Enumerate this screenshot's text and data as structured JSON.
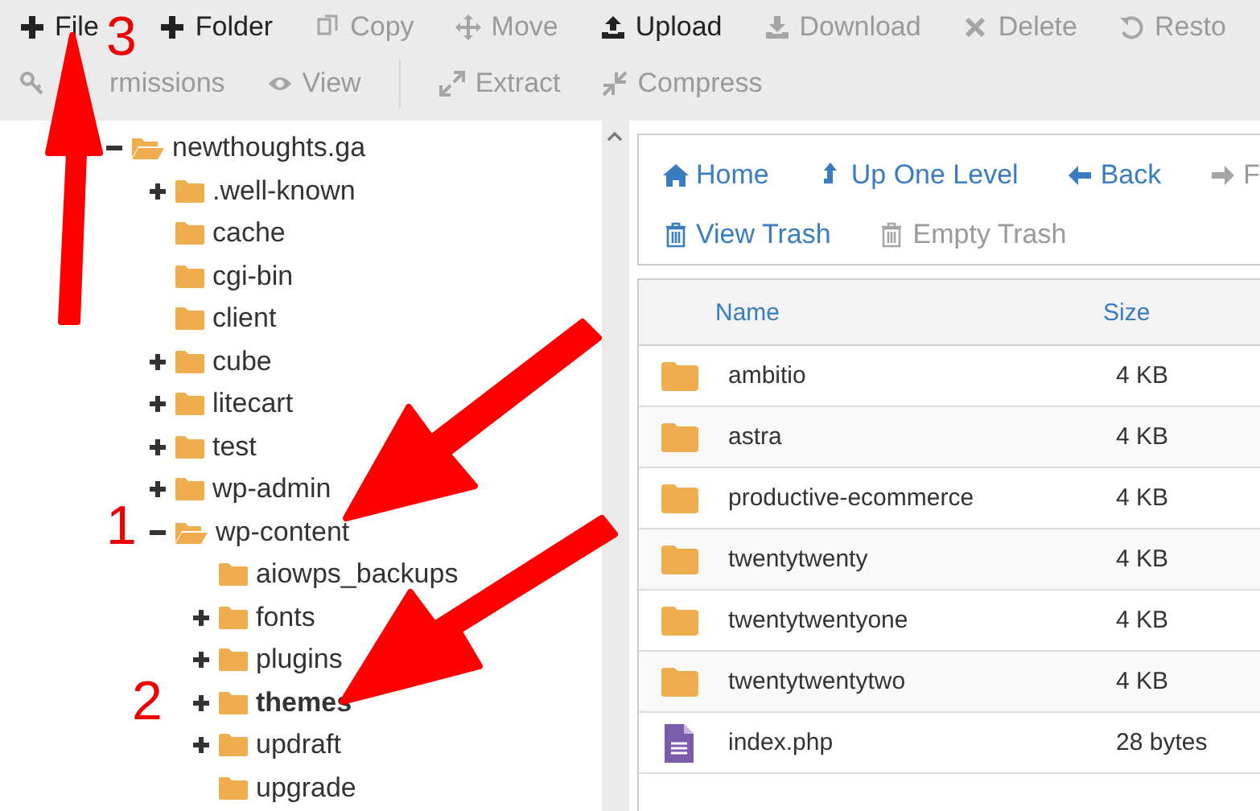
{
  "toolbar": {
    "actions": [
      {
        "kind": "plus",
        "label": "File",
        "disabled": false
      },
      {
        "kind": "plus",
        "label": "Folder",
        "disabled": false
      },
      {
        "kind": "copy",
        "label": "Copy",
        "disabled": true
      },
      {
        "kind": "move",
        "label": "Move",
        "disabled": true
      },
      {
        "kind": "upload",
        "label": "Upload",
        "disabled": false
      },
      {
        "kind": "download",
        "label": "Download",
        "disabled": true
      },
      {
        "kind": "delete",
        "label": "Delete",
        "disabled": true
      },
      {
        "kind": "restore",
        "label": "Resto",
        "disabled": true
      }
    ],
    "tools": [
      {
        "kind": "key",
        "label": "rmissions",
        "disabled": true
      },
      {
        "kind": "eye",
        "label": "View",
        "disabled": true
      },
      {
        "kind": "extract",
        "label": "Extract",
        "disabled": true
      },
      {
        "kind": "compress",
        "label": "Compress",
        "disabled": true
      }
    ]
  },
  "tree": [
    {
      "name": "newthoughts.ga",
      "has_children": true,
      "expanded": true,
      "selected": false,
      "children": [
        {
          "name": ".well-known",
          "has_children": true,
          "expanded": false,
          "selected": false
        },
        {
          "name": "cache",
          "has_children": false,
          "expanded": false,
          "selected": false
        },
        {
          "name": "cgi-bin",
          "has_children": false,
          "expanded": false,
          "selected": false
        },
        {
          "name": "client",
          "has_children": false,
          "expanded": false,
          "selected": false
        },
        {
          "name": "cube",
          "has_children": true,
          "expanded": false,
          "selected": false
        },
        {
          "name": "litecart",
          "has_children": true,
          "expanded": false,
          "selected": false
        },
        {
          "name": "test",
          "has_children": true,
          "expanded": false,
          "selected": false
        },
        {
          "name": "wp-admin",
          "has_children": true,
          "expanded": false,
          "selected": false
        },
        {
          "name": "wp-content",
          "has_children": true,
          "expanded": true,
          "selected": false,
          "children": [
            {
              "name": "aiowps_backups",
              "has_children": false,
              "expanded": false,
              "selected": false
            },
            {
              "name": "fonts",
              "has_children": true,
              "expanded": false,
              "selected": false
            },
            {
              "name": "plugins",
              "has_children": true,
              "expanded": false,
              "selected": false
            },
            {
              "name": "themes",
              "has_children": true,
              "expanded": false,
              "selected": true
            },
            {
              "name": "updraft",
              "has_children": true,
              "expanded": false,
              "selected": false
            },
            {
              "name": "upgrade",
              "has_children": false,
              "expanded": false,
              "selected": false
            }
          ]
        }
      ]
    }
  ],
  "nav": {
    "rows": [
      [
        {
          "kind": "home",
          "label": "Home",
          "disabled": false
        },
        {
          "kind": "up",
          "label": "Up One Level",
          "disabled": false
        },
        {
          "kind": "back",
          "label": "Back",
          "disabled": false
        },
        {
          "kind": "forward",
          "label": "F",
          "disabled": true
        }
      ],
      [
        {
          "kind": "trash",
          "label": "View Trash",
          "disabled": false
        },
        {
          "kind": "trash",
          "label": "Empty Trash",
          "disabled": true
        }
      ]
    ]
  },
  "table": {
    "columns": [
      "Name",
      "Size"
    ],
    "rows": [
      {
        "kind": "folder",
        "name": "ambitio",
        "size": "4 KB"
      },
      {
        "kind": "folder",
        "name": "astra",
        "size": "4 KB"
      },
      {
        "kind": "folder",
        "name": "productive-ecommerce",
        "size": "4 KB"
      },
      {
        "kind": "folder",
        "name": "twentytwenty",
        "size": "4 KB"
      },
      {
        "kind": "folder",
        "name": "twentytwentyone",
        "size": "4 KB"
      },
      {
        "kind": "folder",
        "name": "twentytwentytwo",
        "size": "4 KB"
      },
      {
        "kind": "file",
        "name": "index.php",
        "size": "28 bytes"
      }
    ]
  },
  "annotations": [
    {
      "label": "3"
    },
    {
      "label": "1"
    },
    {
      "label": "2"
    }
  ]
}
